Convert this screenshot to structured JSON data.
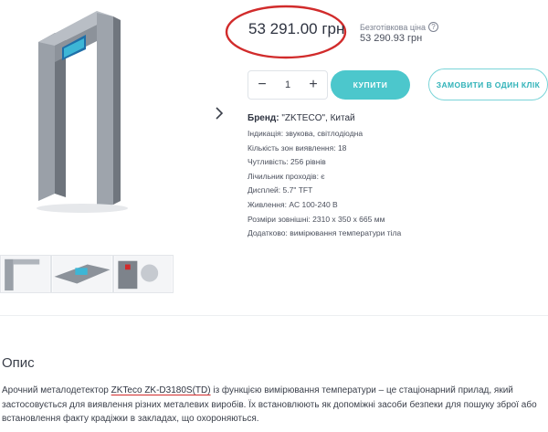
{
  "price": {
    "current": "53 291.00 грн",
    "cashless_label": "Безготівкова ціна",
    "cashless_price": "53 290.93 грн",
    "highlight_color": "#d12b2b"
  },
  "cart": {
    "qty_minus": "−",
    "qty_value": "1",
    "qty_plus": "+",
    "buy_label": "КУПИТИ",
    "one_click_label": "ЗАМОВИТИ В ОДИН КЛІК",
    "accent_color": "#4cc7cc"
  },
  "specs": {
    "brand_label": "Бренд:",
    "brand_value": "\"ZKTECO\", Китай",
    "lines": [
      "Індикація: звукова, світлодіодна",
      "Кількість зон виявлення: 18",
      "Чутливість: 256 рівнів",
      "Лічильник проходів: є",
      "Дисплей: 5.7\" TFT",
      "Живлення: AC 100-240 В",
      "Розміри зовнішні: 2310 x 350 x 665 мм",
      "Додатково: вимірювання температури тіла"
    ]
  },
  "gallery": {
    "next_icon": "chevron-right-icon"
  },
  "description": {
    "title": "Опис",
    "text_before": "Арочний металодетектор ",
    "model": "ZKTeco ZK-D3180S(TD)",
    "text_after": " із функцією вимірювання температури – це стаціонарний прилад, який застосовується для виявлення різних металевих виробів. Їх встановлюють як допоміжні засоби безпеки для пошуку зброї або встановлення факту крадіжки в закладах, що охороняються."
  }
}
